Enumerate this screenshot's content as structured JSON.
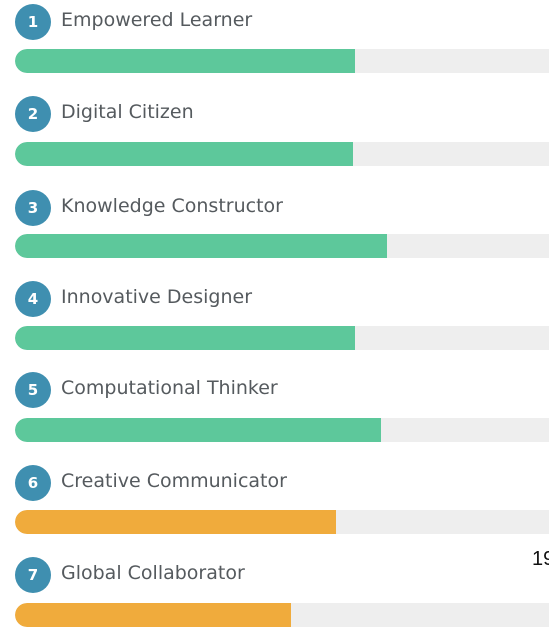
{
  "colors": {
    "badge": "#3f8fb0",
    "track": "#eeeeee",
    "green": "#5dc89b",
    "orange": "#f0ab3c",
    "label": "#555a5e"
  },
  "items": [
    {
      "number": "1",
      "label": "Empowered Learner",
      "progress": 0.636,
      "color": "#5dc89b"
    },
    {
      "number": "2",
      "label": "Digital Citizen",
      "progress": 0.633,
      "color": "#5dc89b"
    },
    {
      "number": "3",
      "label": "Knowledge Constructor",
      "progress": 0.697,
      "color": "#5dc89b"
    },
    {
      "number": "4",
      "label": "Innovative Designer",
      "progress": 0.636,
      "color": "#5dc89b"
    },
    {
      "number": "5",
      "label": "Computational Thinker",
      "progress": 0.685,
      "color": "#5dc89b"
    },
    {
      "number": "6",
      "label": "Creative Communicator",
      "progress": 0.601,
      "color": "#f0ab3c"
    },
    {
      "number": "7",
      "label": "Global Collaborator",
      "progress": 0.517,
      "color": "#f0ab3c"
    }
  ],
  "stray_text": "19"
}
